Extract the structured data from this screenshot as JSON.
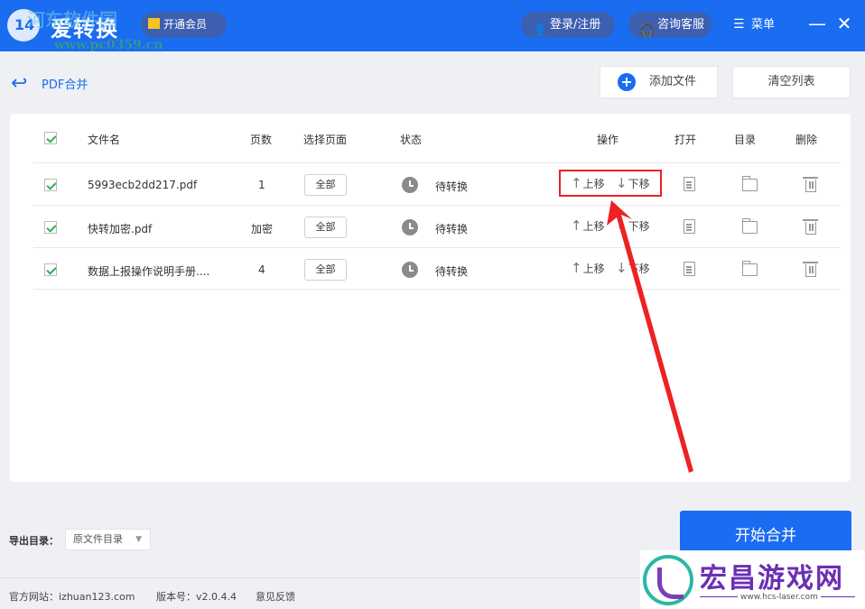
{
  "app": {
    "title": "爱转换",
    "logo_text": "14",
    "watermark_top": "河东软件园",
    "watermark_url": "www.pc0359.cn"
  },
  "header": {
    "vip_label": "开通会员",
    "login_label": "登录/注册",
    "service_label": "咨询客服",
    "menu_label": "菜单",
    "minimize_glyph": "—",
    "close_glyph": "✕"
  },
  "toolbar": {
    "breadcrumb": "PDF合并",
    "add_file_label": "添加文件",
    "clear_list_label": "清空列表"
  },
  "table": {
    "headers": {
      "filename": "文件名",
      "pages": "页数",
      "select_pages": "选择页面",
      "status": "状态",
      "actions": "操作",
      "open": "打开",
      "directory": "目录",
      "delete": "删除"
    },
    "rows": [
      {
        "checked": true,
        "filename": "5993ecb2dd217.pdf",
        "pages": "1",
        "select_label": "全部",
        "status": "待转换",
        "up_label": "上移",
        "down_label": "下移"
      },
      {
        "checked": true,
        "filename": "快转加密.pdf",
        "pages": "加密",
        "select_label": "全部",
        "status": "待转换",
        "up_label": "上移",
        "down_label": "下移"
      },
      {
        "checked": true,
        "filename": "数据上报操作说明手册....",
        "pages": "4",
        "select_label": "全部",
        "status": "待转换",
        "up_label": "上移",
        "down_label": "下移"
      }
    ]
  },
  "export": {
    "label": "导出目录：",
    "value": "原文件目录"
  },
  "start_button": "开始合并",
  "footer": {
    "website": "官方网站：izhuan123.com",
    "version": "版本号：v2.0.4.4",
    "feedback": "意见反馈"
  },
  "corner_watermark": {
    "title": "宏昌游戏网",
    "url": "www.hcs-laser.com"
  },
  "colors": {
    "brand_blue": "#1a6cf0",
    "highlight_red": "#ee2222",
    "check_green": "#2fae5a"
  }
}
